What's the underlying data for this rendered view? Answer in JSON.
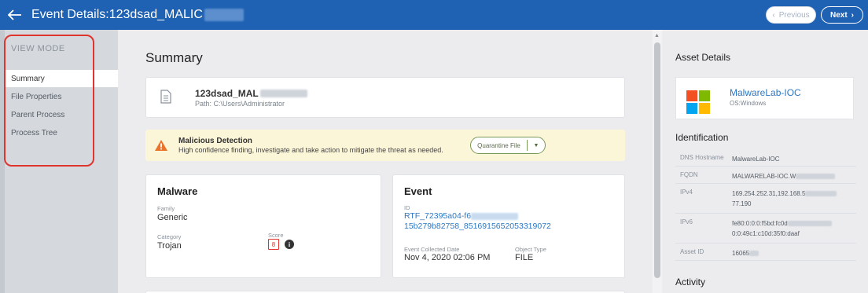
{
  "header": {
    "title": "Event Details:123dsad_MALIC",
    "previous_label": "Previous",
    "next_label": "Next",
    "prev_icon": "‹",
    "next_icon": "›"
  },
  "sidebar": {
    "heading": "VIEW MODE",
    "items": [
      {
        "label": "Summary",
        "active": true
      },
      {
        "label": "File Properties"
      },
      {
        "label": "Parent Process"
      },
      {
        "label": "Process Tree"
      }
    ]
  },
  "summary": {
    "title": "Summary",
    "file": {
      "name": "123dsad_MAL",
      "path": "Path: C:\\Users\\Administrator"
    },
    "alert": {
      "title": "Malicious Detection",
      "description": "High confidence finding, investigate and take action to mitigate the threat as needed.",
      "action_label": "Quarantine File",
      "action_caret": "▼"
    },
    "malware": {
      "title": "Malware",
      "family_label": "Family",
      "family_value": "Generic",
      "category_label": "Category",
      "category_value": "Trojan",
      "score_label": "Score",
      "score_value": "8",
      "info_glyph": "i"
    },
    "event": {
      "title": "Event",
      "id_label": "ID",
      "id_line1": "RTF_72395a04-f6",
      "id_line2": "15b279b82758_8516915652053319072",
      "collected_label": "Event Collected Date",
      "collected_value": "Nov 4, 2020 02:06 PM",
      "object_type_label": "Object Type",
      "object_type_value": "FILE"
    }
  },
  "asset": {
    "section_title": "Asset Details",
    "name": "MalwareLab-IOC",
    "os": "OS:Windows",
    "logo_colors": [
      "#f25022",
      "#7fba00",
      "#00a4ef",
      "#ffb900"
    ]
  },
  "identification": {
    "section_title": "Identification",
    "rows": [
      {
        "key": "DNS Hostname",
        "value": "MalwareLab-IOC"
      },
      {
        "key": "FQDN",
        "value": "MALWARELAB-IOC.W"
      },
      {
        "key": "IPv4",
        "value": "169.254.252.31,192.168.5",
        "value2": "77.190"
      },
      {
        "key": "IPv6",
        "value": "fe80:0:0:0:f5bd:fc0d",
        "value2": "0:0:49c1:c10d:35f0:daaf"
      },
      {
        "key": "Asset ID",
        "value": "16065"
      }
    ]
  },
  "activity": {
    "section_title": "Activity"
  },
  "colors": {
    "header_bg": "#1f61b3",
    "link": "#2c78c4",
    "alert_bg": "#fcf6d9",
    "score_red": "#e0342f",
    "annotation_red": "#e0342f"
  }
}
